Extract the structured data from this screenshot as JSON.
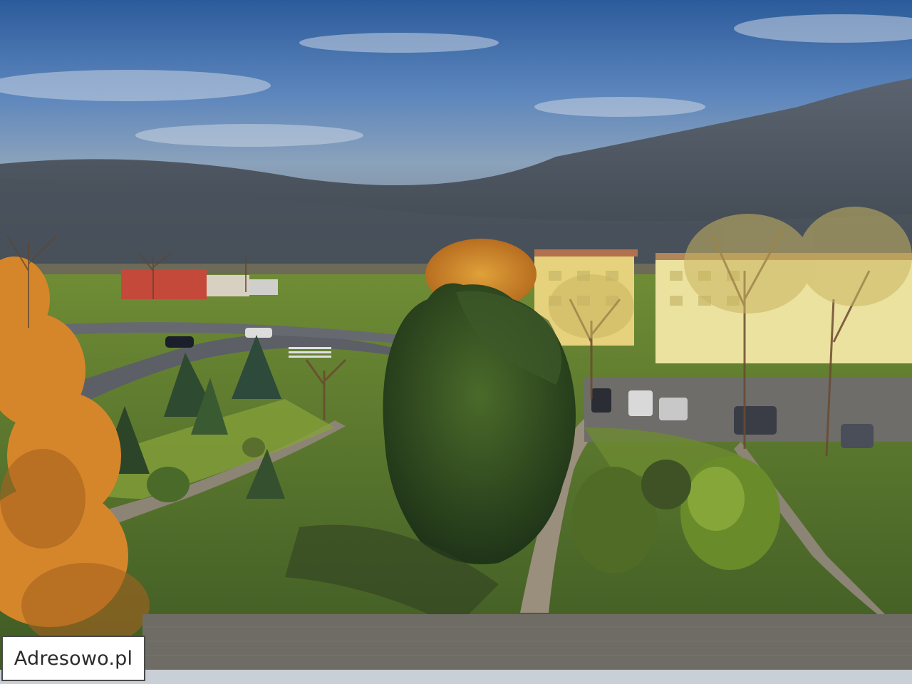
{
  "photo": {
    "scene": "park-with-trees-and-road",
    "colors": {
      "sky_top": "#2f5f9e",
      "sky_mid": "#5f87bd",
      "cloud_band": "#4e5763",
      "grass": "#56752e",
      "grass_lit": "#8aa43a",
      "autumn_leaves": "#d98a2a",
      "road": "#5c5f66",
      "building": "#e9dd92"
    }
  },
  "watermark": {
    "text": "Adresowo.pl"
  }
}
